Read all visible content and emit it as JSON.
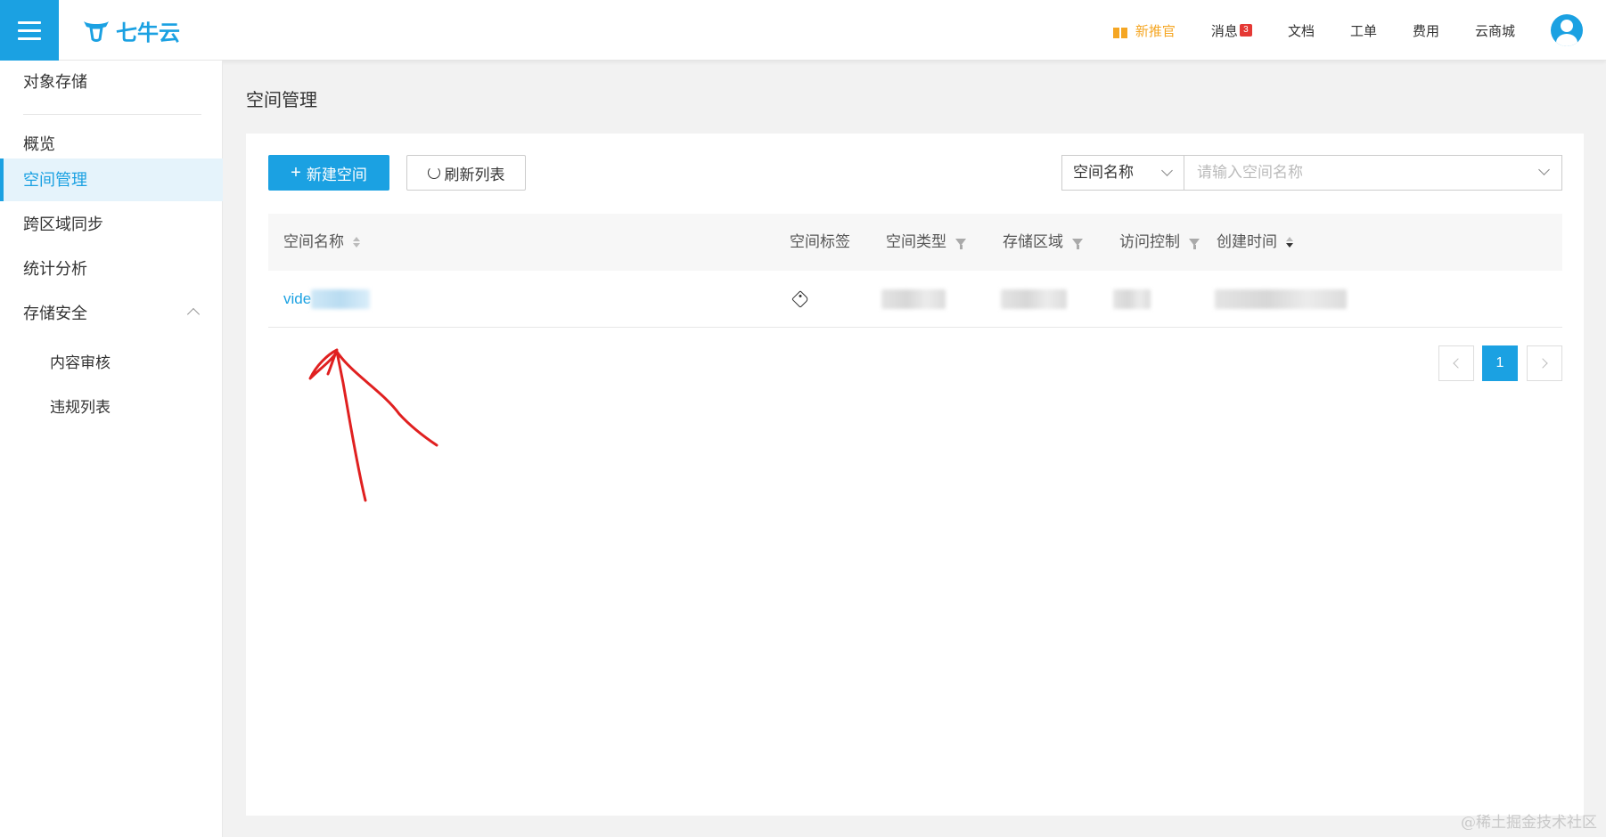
{
  "header": {
    "brand": "七牛云",
    "nav": {
      "promo": "新推官",
      "messages": "消息",
      "message_count": "3",
      "docs": "文档",
      "tickets": "工单",
      "billing": "费用",
      "marketplace": "云商城"
    }
  },
  "sidebar": {
    "section_title": "对象存储",
    "items": [
      "概览",
      "空间管理",
      "跨区域同步",
      "统计分析",
      "存储安全"
    ],
    "sub_items": [
      "内容审核",
      "违规列表"
    ],
    "active": "空间管理"
  },
  "page": {
    "title": "空间管理",
    "new_bucket_label": "新建空间",
    "refresh_label": "刷新列表",
    "search_field": "空间名称",
    "search_placeholder": "请输入空间名称"
  },
  "table": {
    "columns": [
      "空间名称",
      "空间标签",
      "空间类型",
      "存储区域",
      "访问控制",
      "创建时间"
    ],
    "rows": [
      {
        "name": "vide"
      }
    ]
  },
  "pagination": {
    "current": "1"
  },
  "colors": {
    "accent": "#1ba1e2",
    "promo": "#f5a623",
    "annotation": "#e02020"
  },
  "watermark": "@稀土掘金技术社区"
}
